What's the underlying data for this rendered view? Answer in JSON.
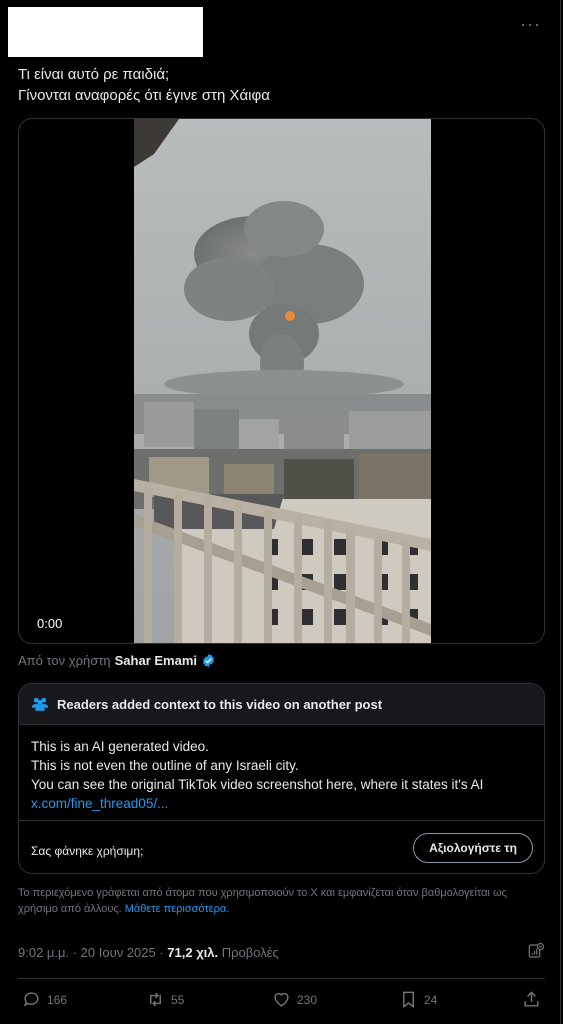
{
  "post": {
    "menu_label": "···",
    "text_lines": [
      "Τι είναι αυτό ρε παιδιά;",
      "Γίνονται αναφορές ότι έγινε στη Χάιφα"
    ]
  },
  "media": {
    "timecode": "0:00"
  },
  "attribution": {
    "prefix": "Από τον χρήστη",
    "user": "Sahar Emami"
  },
  "community_note": {
    "header": "Readers added context to this video on another post",
    "lines": [
      "This is an AI generated video.",
      "This is not even the outline of any Israeli city.",
      "You can see the original TikTok video screenshot here, where it states it's AI"
    ],
    "link": "x.com/fine_thread05/...",
    "helpful_question": "Σας φάνηκε χρήσιμη;",
    "rate_button": "Αξιολογήστε τη"
  },
  "disclaimer": {
    "text": "Το περιεχόμενο γράφεται από άτομα που χρησιμοποιούν το X και εμφανίζεται όταν βαθμολογείται ως χρήσιμο από άλλους.",
    "learn_more": "Μάθετε περισσότερα."
  },
  "meta": {
    "time": "9:02 μ.μ. · 20 Ιουν 2025 · ",
    "views_count": "71,2 χιλ.",
    "views_label": "Προβολές"
  },
  "actions": {
    "replies": "166",
    "reposts": "55",
    "likes": "230",
    "bookmarks": "24"
  },
  "colors": {
    "background": "#000000",
    "text": "#e7e9ea",
    "muted": "#71767b",
    "accent": "#1d9bf0",
    "border": "#2f3336"
  }
}
